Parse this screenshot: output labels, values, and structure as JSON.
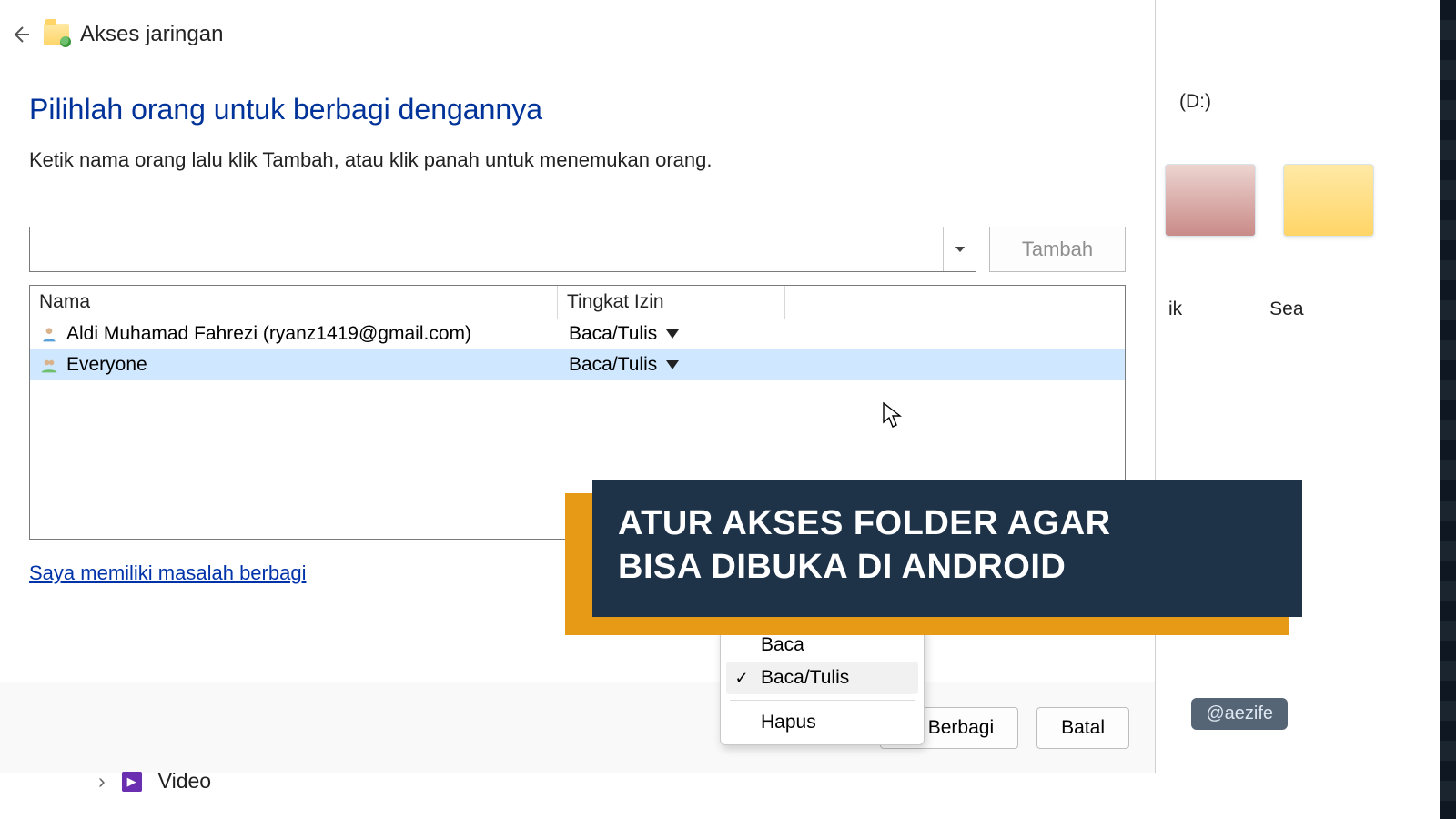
{
  "header": {
    "title": "Akses jaringan"
  },
  "heading": "Pilihlah orang untuk berbagi dengannya",
  "subtext": "Ketik nama orang lalu klik Tambah, atau klik panah untuk menemukan orang.",
  "name_input": {
    "value": ""
  },
  "add_button": "Tambah",
  "columns": {
    "name": "Nama",
    "perm": "Tingkat Izin"
  },
  "rows": [
    {
      "name": "Aldi Muhamad Fahrezi (ryanz1419@gmail.com)",
      "perm": "Baca/Tulis",
      "selected": false
    },
    {
      "name": "Everyone",
      "perm": "Baca/Tulis",
      "selected": true
    }
  ],
  "perm_menu": {
    "items": [
      {
        "label": "Baca",
        "checked": false
      },
      {
        "label": "Baca/Tulis",
        "checked": true
      }
    ],
    "divider_then": {
      "label": "Hapus"
    }
  },
  "help_link": "Saya memiliki masalah berbagi",
  "footer": {
    "share": "Berbagi",
    "cancel": "Batal"
  },
  "explorer": {
    "drive_suffix": "(D:)",
    "label_right_1": "ik",
    "label_right_2": "Sea"
  },
  "bottom_tree": {
    "label": "Video"
  },
  "banner": {
    "line1": "ATUR AKSES FOLDER AGAR",
    "line2": "BISA DIBUKA DI ANDROID"
  },
  "watermark": "@aezife"
}
